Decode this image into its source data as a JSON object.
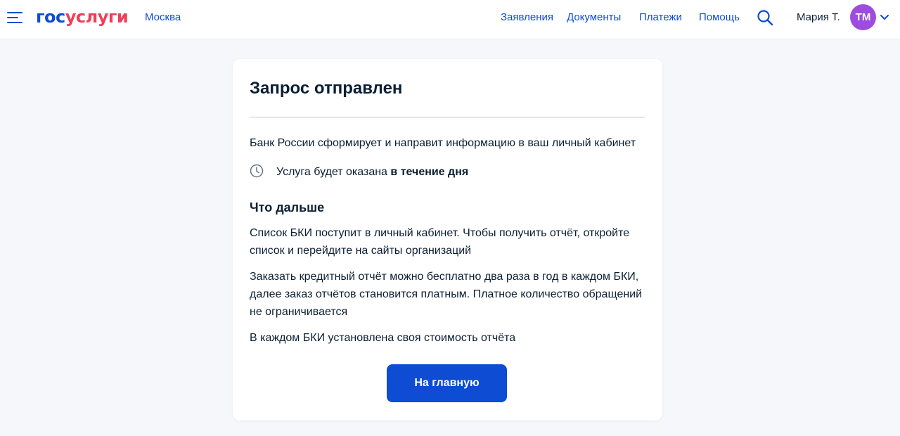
{
  "header": {
    "logo_part1": "гос",
    "logo_part2": "услуги",
    "region": "Москва",
    "nav": [
      "Заявления",
      "Документы",
      "Платежи",
      "Помощь"
    ],
    "user_name": "Мария Т.",
    "avatar_initials": "ТМ"
  },
  "card": {
    "title": "Запрос отправлен",
    "info": "Банк России сформирует и направит информацию в ваш личный кабинет",
    "service_prefix": "Услуга будет оказана ",
    "service_bold": "в течение дня",
    "next_heading": "Что дальше",
    "paragraphs": [
      "Список БКИ поступит в личный кабинет. Чтобы получить отчёт, откройте список и перейдите на сайты организаций",
      "Заказать кредитный отчёт можно бесплатно два раза в год в каждом БКИ, далее заказ отчётов становится платным. Платное количество обращений не ограничивается",
      "В каждом БКИ установлена своя стоимость отчёта"
    ],
    "button_label": "На главную"
  },
  "colors": {
    "brand_blue": "#0d4cd3",
    "brand_red": "#ee3f58",
    "avatar_bg": "#9e4ce0",
    "page_bg": "#f5f7fa"
  },
  "icons": {
    "menu": "menu-icon",
    "search": "search-icon",
    "chevron": "chevron-down-icon",
    "clock": "clock-icon"
  }
}
